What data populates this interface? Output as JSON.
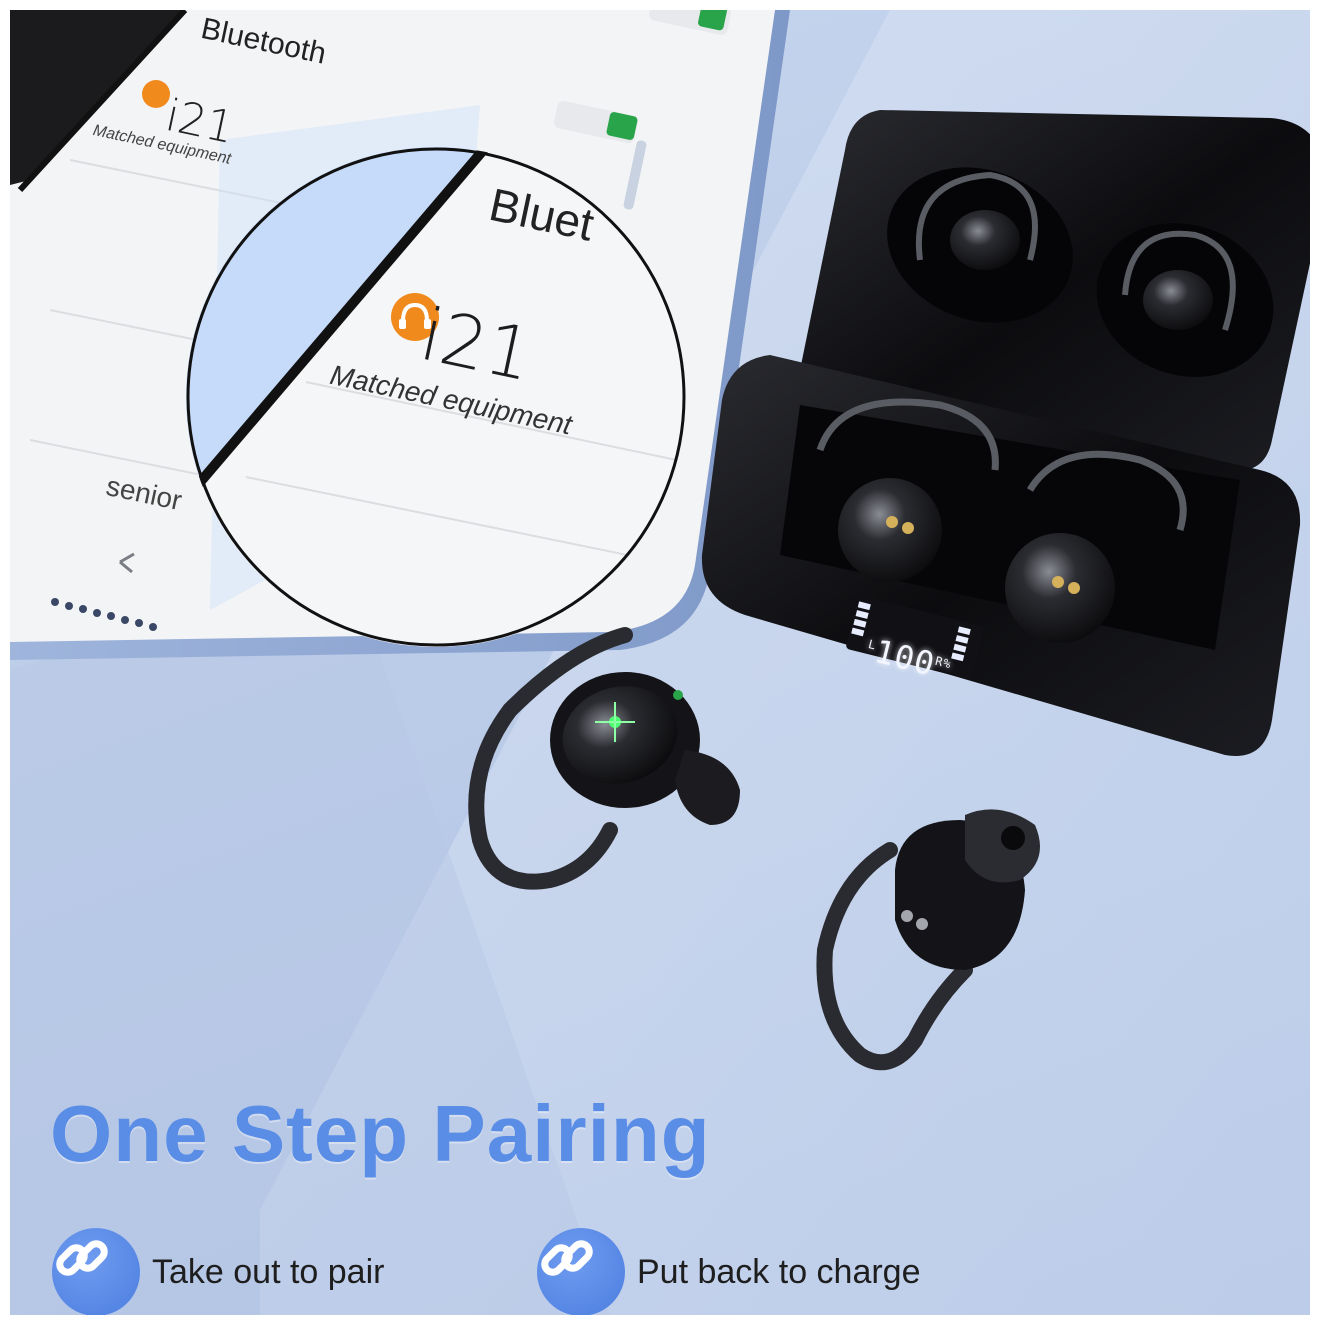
{
  "phone": {
    "bluetooth_title": "Bluetooth",
    "device_name": "i21",
    "device_status": "Matched equipment",
    "bottom_label": "senior"
  },
  "magnifier": {
    "bluetooth_title": "Bluet",
    "device_name": "i21",
    "device_status": "Matched equipment"
  },
  "case_display": {
    "left_label": "L",
    "battery_level": "100",
    "right_label": "R",
    "unit": "%"
  },
  "headline": "One Step Pairing",
  "features": [
    {
      "label": "Take out to pair",
      "icon": "link-icon"
    },
    {
      "label": "Put back to charge",
      "icon": "link-icon"
    }
  ],
  "colors": {
    "headline": "#5a8de6",
    "badge": "#4c7ee0",
    "accent_orange": "#f08a1c",
    "toggle_green": "#2aa44a"
  }
}
